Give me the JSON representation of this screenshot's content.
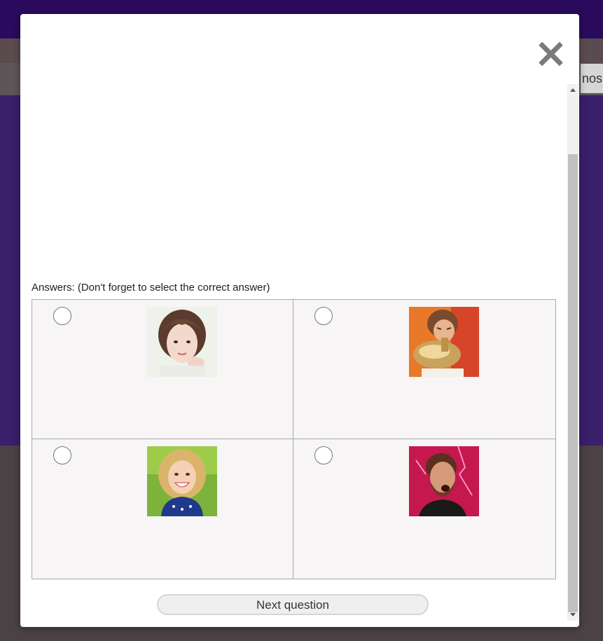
{
  "background": {
    "tab_fragment": "nos"
  },
  "modal": {
    "close_icon": "close-x-icon",
    "answers_label": "Answers: (Don't forget to select the correct answer)",
    "answers": [
      {
        "image": "portrait-young-woman",
        "selected": false
      },
      {
        "image": "child-playing-tuba",
        "selected": false
      },
      {
        "image": "smiling-girl-outdoors",
        "selected": false
      },
      {
        "image": "bearded-man-shouting",
        "selected": false
      }
    ],
    "next_button_label": "Next question"
  },
  "colors": {
    "topbar": "#2a0a5c",
    "hero": "#3a1f6b",
    "cell_bg": "#f7f5f5",
    "cell_border": "#a8a8a8"
  }
}
